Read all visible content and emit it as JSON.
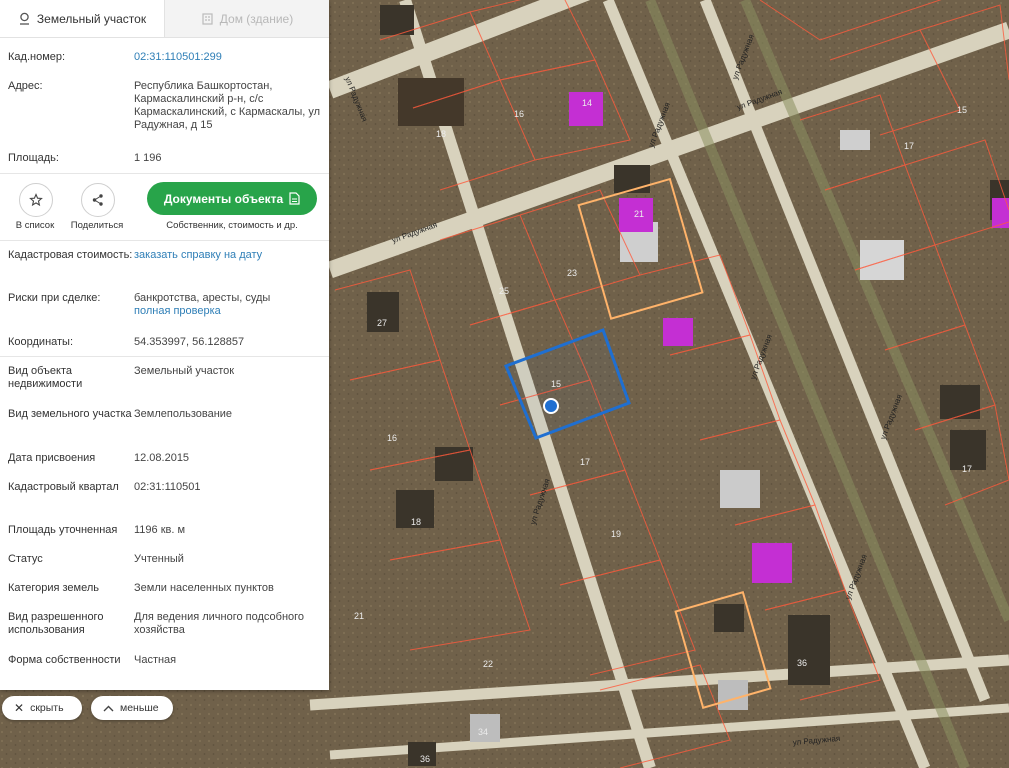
{
  "tabs": {
    "land": "Земельный участок",
    "house": "Дом (здание)"
  },
  "map": {
    "streets": [
      "ул Радужная",
      "ул Радужная",
      "ул Радужная",
      "ул Радужная",
      "ул Радужная",
      "ул Радужная",
      "ул Радужная",
      "ул Радужная",
      "ул Радужная",
      "ул Радужная"
    ],
    "plot_numbers": [
      "14",
      "16",
      "18",
      "15",
      "17",
      "21",
      "23",
      "25",
      "27",
      "16",
      "18",
      "19",
      "15",
      "17",
      "36",
      "22",
      "34",
      "36",
      "17",
      "21"
    ],
    "selected_plot": "15",
    "colors": {
      "selected_outline": "#1f6fd1",
      "boundary": "#ff5a3c",
      "building": "#c42fd3",
      "street": "#d8d2bd"
    }
  },
  "info": {
    "cad_number_label": "Кад.номер:",
    "cad_number": "02:31:110501:299",
    "address_label": "Адрес:",
    "address": "Республика Башкортостан, Кармаскалинский р-н, с/с Кармаскалинский, с Кармаскалы, ул Радужная, д 15",
    "area_label": "Площадь:",
    "area": "1 196",
    "cadastral_value_label": "Кадастровая стоимость:",
    "cadastral_value": "заказать справку на дату",
    "risks_label": "Риски при сделке:",
    "risks": "банкротства, аресты, суды",
    "risks_link": "полная проверка",
    "coords_label": "Координаты:",
    "coords": "54.353997, 56.128857",
    "object_type_label": "Вид объекта недвижимости",
    "object_type": "Земельный участок",
    "land_type_label": "Вид земельного участка",
    "land_type": "Землепользование",
    "assign_date_label": "Дата присвоения",
    "assign_date": "12.08.2015",
    "quarter_label": "Кадастровый квартал",
    "quarter": "02:31:110501",
    "refined_area_label": "Площадь уточненная",
    "refined_area": "1196 кв. м",
    "status_label": "Статус",
    "status": "Учтенный",
    "category_label": "Категория земель",
    "category": "Земли населенных пунктов",
    "permitted_use_label": "Вид разрешенного использования",
    "permitted_use": "Для ведения личного подсобного хозяйства",
    "ownership_label": "Форма собственности",
    "ownership": "Частная"
  },
  "actions": {
    "to_list": "В список",
    "share": "Поделиться",
    "documents": "Документы объекта",
    "documents_sub": "Собственник, стоимость и др."
  },
  "bottom": {
    "hide": "скрыть",
    "less": "меньше"
  }
}
